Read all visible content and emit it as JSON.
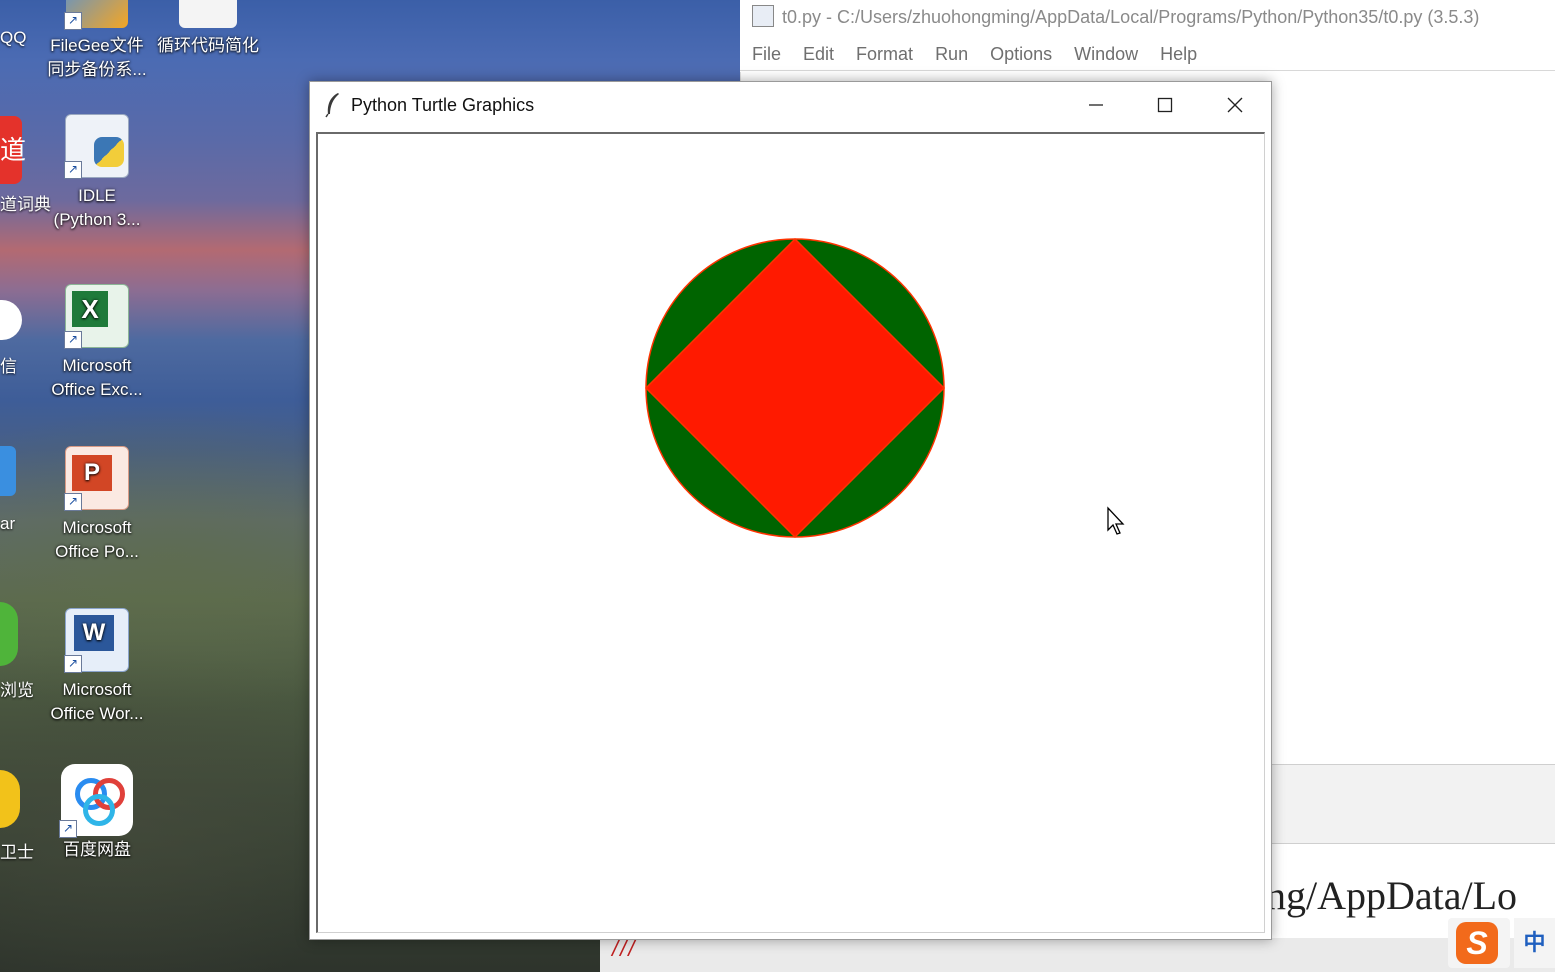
{
  "desktop": {
    "icons": [
      {
        "label_line1": "FileGee文件",
        "label_line2": "同步备份系..."
      },
      {
        "label_line1": "循环代码简化",
        "label_line2": ""
      },
      {
        "label_line1": "IDLE",
        "label_line2": "(Python 3..."
      },
      {
        "label_line1": "Microsoft",
        "label_line2": "Office Exc..."
      },
      {
        "label_line1": "Microsoft",
        "label_line2": "Office Po..."
      },
      {
        "label_line1": "Microsoft",
        "label_line2": "Office Wor..."
      },
      {
        "label_line1": "百度网盘",
        "label_line2": ""
      }
    ],
    "partial_labels": [
      "QQ",
      "道词典",
      "信",
      "ar",
      "浏览",
      "卫士"
    ]
  },
  "idle": {
    "title": "t0.py - C:/Users/zhuohongming/AppData/Local/Programs/Python/Python35/t0.py (3.5.3)",
    "menu": [
      "File",
      "Edit",
      "Format",
      "Run",
      "Options",
      "Window",
      "Help"
    ],
    "path_fragment": "ng/AppData/Lo"
  },
  "turtle_window": {
    "title": "Python Turtle Graphics",
    "controls": {
      "minimize": "—",
      "maximize": "☐",
      "close": "✕"
    },
    "drawing": {
      "circle_fill": "#006400",
      "square_fill": "#ff1a00",
      "outline": "#ff3300"
    }
  },
  "tray": {
    "ime_label": "中",
    "sogou_label": "S"
  }
}
